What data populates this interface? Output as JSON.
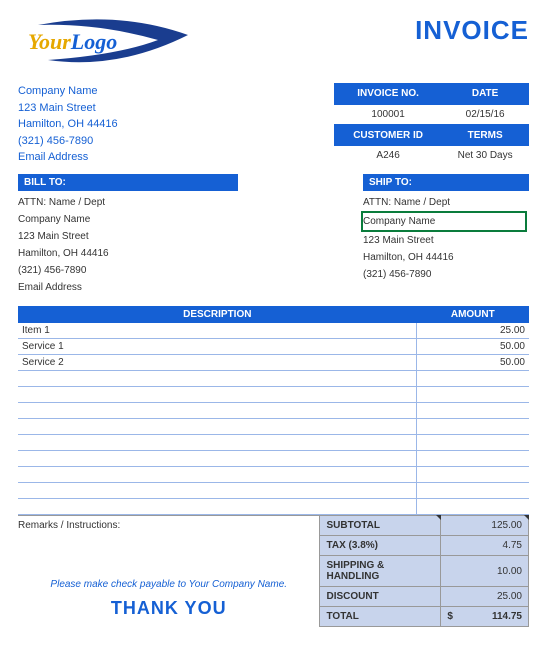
{
  "logo": {
    "your": "Your",
    "logo": "Logo"
  },
  "title": "INVOICE",
  "company": {
    "name": "Company Name",
    "street": "123 Main Street",
    "citystate": "Hamilton, OH  44416",
    "phone": "(321) 456-7890",
    "email": "Email Address"
  },
  "meta": {
    "h_invoice": "INVOICE NO.",
    "h_date": "DATE",
    "invoice_no": "100001",
    "date": "02/15/16",
    "h_customer": "CUSTOMER ID",
    "h_terms": "TERMS",
    "customer_id": "A246",
    "terms": "Net 30 Days"
  },
  "billto": {
    "header": "BILL TO:",
    "attn": "ATTN: Name / Dept",
    "company": "Company Name",
    "street": "123 Main Street",
    "citystate": "Hamilton, OH  44416",
    "phone": "(321) 456-7890",
    "email": "Email Address"
  },
  "shipto": {
    "header": "SHIP TO:",
    "attn": "ATTN: Name / Dept",
    "company": "Company Name",
    "street": "123 Main Street",
    "citystate": "Hamilton, OH  44416",
    "phone": "(321) 456-7890"
  },
  "items_header": {
    "desc": "DESCRIPTION",
    "amt": "AMOUNT"
  },
  "items": [
    {
      "desc": "Item 1",
      "amt": "25.00"
    },
    {
      "desc": "Service 1",
      "amt": "50.00"
    },
    {
      "desc": "Service 2",
      "amt": "50.00"
    },
    {
      "desc": "",
      "amt": ""
    },
    {
      "desc": "",
      "amt": ""
    },
    {
      "desc": "",
      "amt": ""
    },
    {
      "desc": "",
      "amt": ""
    },
    {
      "desc": "",
      "amt": ""
    },
    {
      "desc": "",
      "amt": ""
    },
    {
      "desc": "",
      "amt": ""
    },
    {
      "desc": "",
      "amt": ""
    },
    {
      "desc": "",
      "amt": ""
    }
  ],
  "remarks_label": "Remarks / Instructions:",
  "payable": "Please make check payable to Your Company Name.",
  "thanks": "THANK YOU",
  "totals": {
    "subtotal_lbl": "SUBTOTAL",
    "subtotal_val": "125.00",
    "tax_lbl": "TAX (3.8%)",
    "tax_val": "4.75",
    "ship_lbl": "SHIPPING & HANDLING",
    "ship_val": "10.00",
    "discount_lbl": "DISCOUNT",
    "discount_val": "25.00",
    "total_lbl": "TOTAL",
    "total_val": "114.75"
  }
}
